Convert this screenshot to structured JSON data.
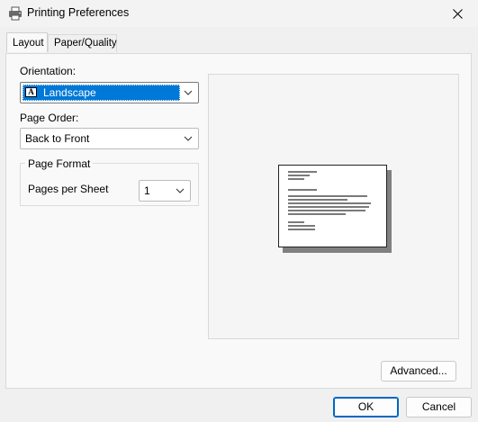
{
  "window": {
    "title": "Printing Preferences",
    "icon": "printer-icon",
    "close_icon": "close-icon"
  },
  "tabs": [
    {
      "label": "Layout",
      "active": true
    },
    {
      "label": "Paper/Quality",
      "active": false
    }
  ],
  "layout": {
    "orientation": {
      "label": "Orientation:",
      "value": "Landscape",
      "icon_glyph": "A"
    },
    "page_order": {
      "label": "Page Order:",
      "value": "Back to Front"
    },
    "page_format": {
      "title": "Page Format",
      "pages_per_sheet_label": "Pages per Sheet",
      "pages_per_sheet_value": "1"
    },
    "advanced_button": "Advanced..."
  },
  "footer": {
    "ok_label": "OK",
    "cancel_label": "Cancel"
  },
  "colors": {
    "selection": "#0078d7",
    "ok_border": "#0067c0"
  }
}
